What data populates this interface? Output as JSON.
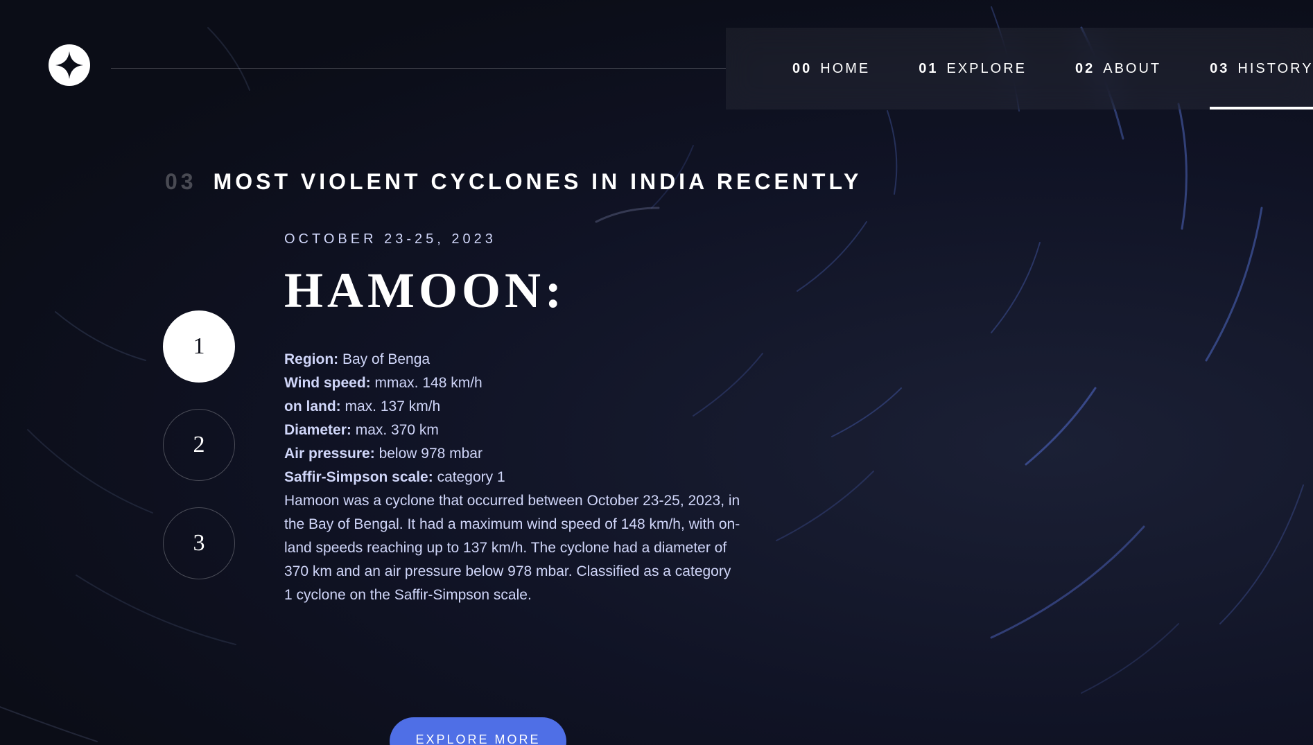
{
  "nav": {
    "items": [
      {
        "num": "00",
        "label": "HOME",
        "active": false
      },
      {
        "num": "01",
        "label": "EXPLORE",
        "active": false
      },
      {
        "num": "02",
        "label": "ABOUT",
        "active": false
      },
      {
        "num": "03",
        "label": "HISTORY",
        "active": true
      }
    ]
  },
  "page": {
    "section_number": "03",
    "section_title": "MOST VIOLENT CYCLONES IN INDIA RECENTLY"
  },
  "cyclone": {
    "date": "OCTOBER 23-25, 2023",
    "name": "HAMOON:",
    "stats": [
      {
        "label": "Region:",
        "value": "Bay of Benga"
      },
      {
        "label": "Wind speed:",
        "value": "mmax. 148 km/h"
      },
      {
        "label": "on land:",
        "value": "max. 137 km/h"
      },
      {
        "label": "Diameter:",
        "value": "max. 370 km"
      },
      {
        "label": "Air pressure:",
        "value": "below 978 mbar"
      },
      {
        "label": "Saffir-Simpson scale:",
        "value": "category 1"
      }
    ],
    "description": "Hamoon was a cyclone that occurred between October 23-25, 2023, in the Bay of Bengal. It had a maximum wind speed of 148 km/h, with on-land speeds reaching up to 137 km/h. The cyclone had a diameter of 370 km and an air pressure below 978 mbar. Classified as a category 1 cyclone on the Saffir-Simpson scale."
  },
  "steps": [
    {
      "label": "1",
      "active": true
    },
    {
      "label": "2",
      "active": false
    },
    {
      "label": "3",
      "active": false
    }
  ],
  "cta": {
    "label": "EXPLORE MORE"
  },
  "colors": {
    "accent": "#4f6fe6",
    "background": "#0b0d17",
    "text_muted": "#d0d6f9"
  },
  "icons": {
    "logo": "star-logo-icon"
  }
}
